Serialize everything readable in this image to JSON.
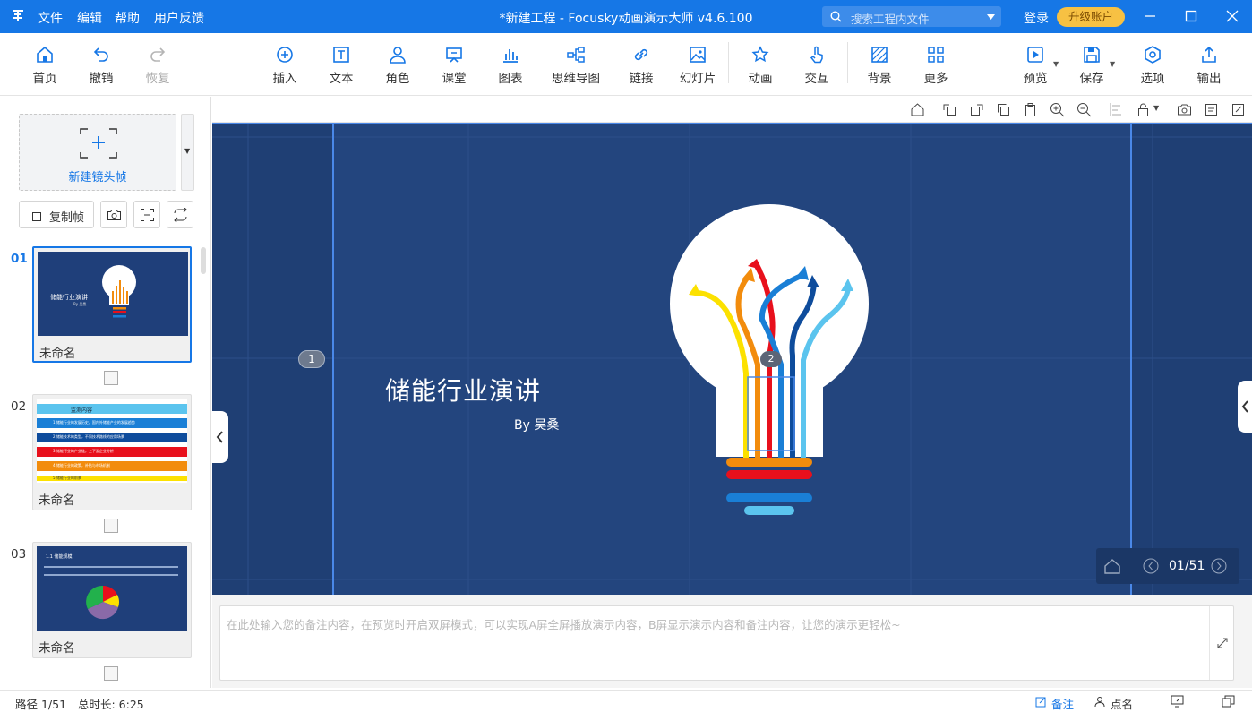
{
  "app": {
    "title": "*新建工程 - Focusky动画演示大师  v4.6.100"
  },
  "menu": [
    "文件",
    "编辑",
    "帮助",
    "用户反馈"
  ],
  "search": {
    "placeholder": "搜索工程内文件"
  },
  "account": {
    "login": "登录",
    "upgrade": "升级账户"
  },
  "toolbar": {
    "home": "首页",
    "undo": "撤销",
    "redo": "恢复",
    "insert": "插入",
    "text": "文本",
    "role": "角色",
    "classroom": "课堂",
    "chart": "图表",
    "mindmap": "思维导图",
    "link": "链接",
    "slides": "幻灯片",
    "animation": "动画",
    "interact": "交互",
    "background": "背景",
    "more": "更多",
    "preview": "预览",
    "save": "保存",
    "options": "选项",
    "export": "输出"
  },
  "sidebar": {
    "new_frame": "新建镜头帧",
    "copy_frame": "复制帧",
    "slides": [
      {
        "num": "01",
        "name": "未命名",
        "thumb_title": "储能行业演讲",
        "thumb_sub": "By 吴桑"
      },
      {
        "num": "02",
        "name": "未命名",
        "thumb_title": "监测内容",
        "lines": [
          "1 储能行业的发展历史，国内外储能产业的发展趋势",
          "2 储能技术的类型，不同技术路线的应用场景",
          "3 储能行业的产业链，上下游企业分析",
          "4 储能行业的政策，补贴与市场机制",
          "5 储能行业的前景"
        ]
      },
      {
        "num": "03",
        "name": "未命名",
        "thumb_title": "1.1 储能规模"
      }
    ]
  },
  "slide": {
    "title": "储能行业演讲",
    "subtitle": "By 吴桑",
    "marker1": "1",
    "marker2": "2"
  },
  "nav": {
    "page": "01/51"
  },
  "notes": {
    "placeholder": "在此处输入您的备注内容，在预览时开启双屏模式，可以实现A屏全屏播放演示内容，B屏显示演示内容和备注内容，让您的演示更轻松~"
  },
  "status": {
    "path": "路径 1/51",
    "duration": "总时长: 6:25",
    "notes_btn": "备注",
    "rollcall_btn": "点名"
  },
  "colors": {
    "brand": "#1677e6",
    "canvas": "#23457e",
    "upgrade": "#f7c143"
  }
}
